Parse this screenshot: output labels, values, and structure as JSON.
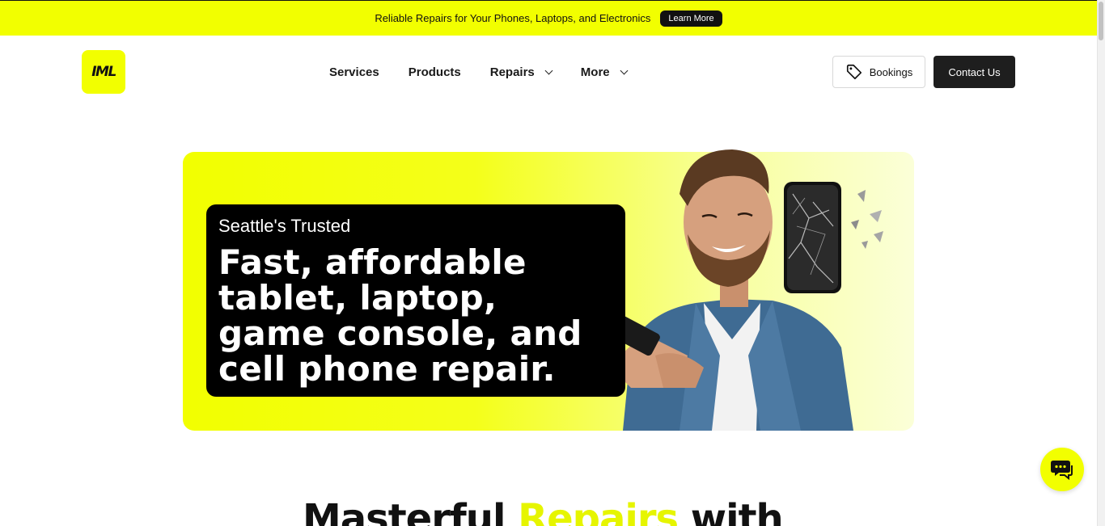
{
  "announcement": {
    "text": "Reliable Repairs for Your Phones, Laptops, and Electronics",
    "button_label": "Learn More"
  },
  "brand": {
    "logo_text": "IML",
    "accent_color": "#f2ff00",
    "dark_color": "#1e1e1e"
  },
  "nav": {
    "items": [
      {
        "label": "Services",
        "has_dropdown": false
      },
      {
        "label": "Products",
        "has_dropdown": false
      },
      {
        "label": "Repairs",
        "has_dropdown": true
      },
      {
        "label": "More",
        "has_dropdown": true
      }
    ]
  },
  "header_actions": {
    "bookings_label": "Bookings",
    "bookings_icon": "tag-icon",
    "contact_label": "Contact Us"
  },
  "hero": {
    "kicker": "Seattle's Trusted",
    "title": "Fast, affordable tablet, laptop, game console, and cell phone repair.",
    "image": "man-with-smartphone-and-cracked-phone"
  },
  "chat": {
    "icon": "chat-bubbles-icon"
  },
  "section": {
    "heading_pre": "Masterful ",
    "heading_accent": "Repairs",
    "heading_post": " with"
  }
}
